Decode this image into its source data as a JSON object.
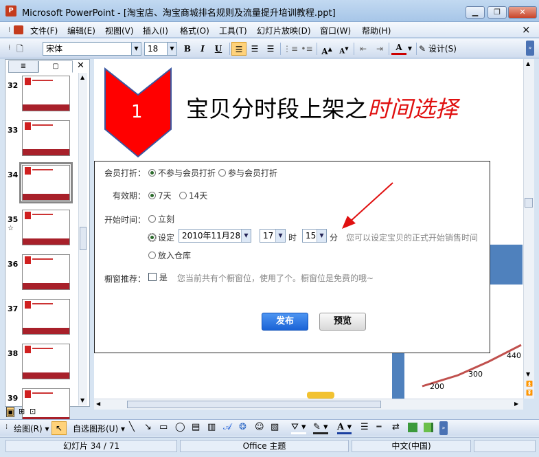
{
  "window": {
    "app_icon_text": "P",
    "title": "Microsoft PowerPoint - [淘宝店、淘宝商城排名规则及流量提升培训教程.ppt]",
    "min_icon": "minimize-icon",
    "restore_icon": "restore-icon",
    "close_icon": "close-icon"
  },
  "menu": {
    "items": [
      "文件(F)",
      "编辑(E)",
      "视图(V)",
      "插入(I)",
      "格式(O)",
      "工具(T)",
      "幻灯片放映(D)",
      "窗口(W)",
      "帮助(H)"
    ],
    "doc_close": "×"
  },
  "toolbar": {
    "font_name": "宋体",
    "font_size": "18",
    "bold": "B",
    "italic": "I",
    "underline": "U",
    "increase_font": "A",
    "decrease_font": "A",
    "font_color": "A",
    "design_label": "设计(S)"
  },
  "thumbnails": {
    "numbers": [
      "32",
      "33",
      "34",
      "35",
      "36",
      "37",
      "38",
      "39"
    ],
    "selected": "34",
    "star": "☆"
  },
  "slide": {
    "badge_number": "1",
    "title_main": "宝贝分时段上架之",
    "title_highlight": "时间选择",
    "chart_labels": [
      "440",
      "300",
      "200"
    ]
  },
  "dialog": {
    "member_discount_label": "会员打折：",
    "member_option_no": "不参与会员打折",
    "member_option_yes": "参与会员打折",
    "validity_label": "有效期：",
    "validity_7": "7天",
    "validity_14": "14天",
    "start_time_label": "开始时间：",
    "start_immediately": "立刻",
    "start_set": "设定",
    "date_value": "2010年11月28日",
    "hour_value": "17",
    "hour_unit": "时",
    "minute_value": "15",
    "minute_unit": "分",
    "set_hint": "您可以设定宝贝的正式开始销售时间",
    "warehouse": "放入仓库",
    "window_recommend_label": "橱窗推荐：",
    "window_yes": "是",
    "window_hint": "您当前共有个橱窗位，使用了个。橱窗位是免费的哦~",
    "publish_button": "发布",
    "preview_button": "预览"
  },
  "drawbar": {
    "draw_label": "绘图(R)",
    "autoshape_label": "自选图形(U)"
  },
  "status": {
    "slide_counter": "幻灯片 34 / 71",
    "theme": "Office 主题",
    "language": "中文(中国)"
  }
}
